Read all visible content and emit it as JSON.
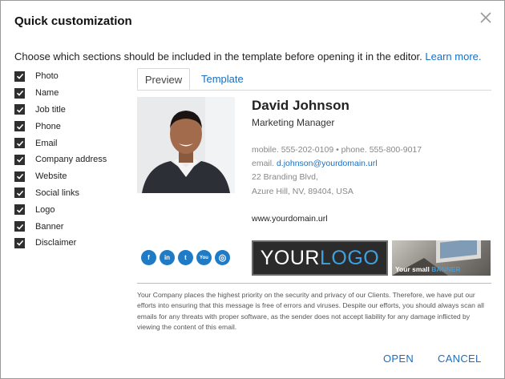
{
  "dialog": {
    "title": "Quick customization",
    "intro": "Choose which sections should be included in the template before opening it in the editor.",
    "learn_more": "Learn more."
  },
  "sections": [
    {
      "label": "Photo",
      "checked": true
    },
    {
      "label": "Name",
      "checked": true
    },
    {
      "label": "Job title",
      "checked": true
    },
    {
      "label": "Phone",
      "checked": true
    },
    {
      "label": "Email",
      "checked": true
    },
    {
      "label": "Company address",
      "checked": true
    },
    {
      "label": "Website",
      "checked": true
    },
    {
      "label": "Social links",
      "checked": true
    },
    {
      "label": "Logo",
      "checked": true
    },
    {
      "label": "Banner",
      "checked": true
    },
    {
      "label": "Disclaimer",
      "checked": true
    }
  ],
  "tabs": {
    "preview": "Preview",
    "template": "Template",
    "active": "Preview"
  },
  "signature": {
    "name": "David Johnson",
    "job_title": "Marketing Manager",
    "phone_line": "mobile. 555-202-0109 • phone. 555-800-9017",
    "email_label": "email.",
    "email": "d.johnson@yourdomain.url",
    "address1": "22 Branding Blvd,",
    "address2": "Azure Hill, NV, 89404, USA",
    "website": "www.yourdomain.url",
    "socials": [
      {
        "name": "facebook",
        "glyph": "f"
      },
      {
        "name": "linkedin",
        "glyph": "in"
      },
      {
        "name": "twitter",
        "glyph": "t"
      },
      {
        "name": "youtube",
        "glyph": "You"
      },
      {
        "name": "instagram",
        "glyph": "◎"
      }
    ],
    "logo_part1": "YOUR",
    "logo_part2": "LOGO",
    "banner_part1": "Your small ",
    "banner_part2": "BANNER"
  },
  "disclaimer": "Your Company places the highest priority on the security and privacy of our Clients. Therefore, we have put our efforts into ensuring that this message is free of errors and viruses. Despite our efforts, you should always scan all emails for any threats with proper software, as the sender does not accept liability for any damage inflicted by viewing the content of this email.",
  "buttons": {
    "open": "OPEN",
    "cancel": "CANCEL"
  },
  "colors": {
    "accent": "#1a6fc2",
    "social": "#1f7bc6",
    "checkbox": "#2f2f2f"
  }
}
